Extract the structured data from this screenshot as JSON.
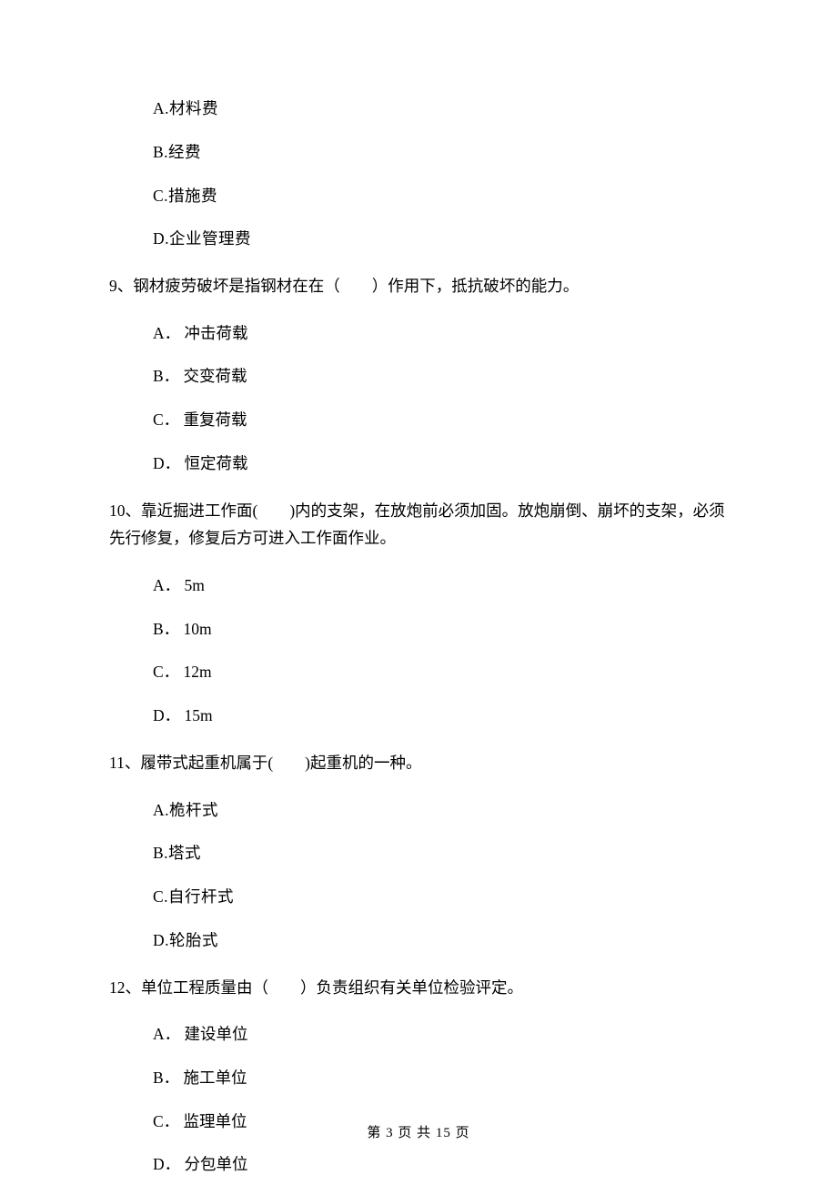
{
  "prevOptions": {
    "a": "A.材料费",
    "b": "B.经费",
    "c": "C.措施费",
    "d": "D.企业管理费"
  },
  "q9": {
    "stem": "9、钢材疲劳破坏是指钢材在在（　　）作用下，抵抗破坏的能力。",
    "a": "A． 冲击荷载",
    "b": "B． 交变荷载",
    "c": "C． 重复荷载",
    "d": "D． 恒定荷载"
  },
  "q10": {
    "stem": "10、靠近掘进工作面(　　)内的支架，在放炮前必须加固。放炮崩倒、崩坏的支架，必须先行修复，修复后方可进入工作面作业。",
    "a": "A． 5m",
    "b": "B． 10m",
    "c": "C． 12m",
    "d": "D． 15m"
  },
  "q11": {
    "stem": "11、履带式起重机属于(　　)起重机的一种。",
    "a": "A.桅杆式",
    "b": "B.塔式",
    "c": "C.自行杆式",
    "d": "D.轮胎式"
  },
  "q12": {
    "stem": "12、单位工程质量由（　　）负责组织有关单位检验评定。",
    "a": "A． 建设单位",
    "b": "B． 施工单位",
    "c": "C． 监理单位",
    "d": "D． 分包单位"
  },
  "footer": "第 3 页 共 15 页"
}
